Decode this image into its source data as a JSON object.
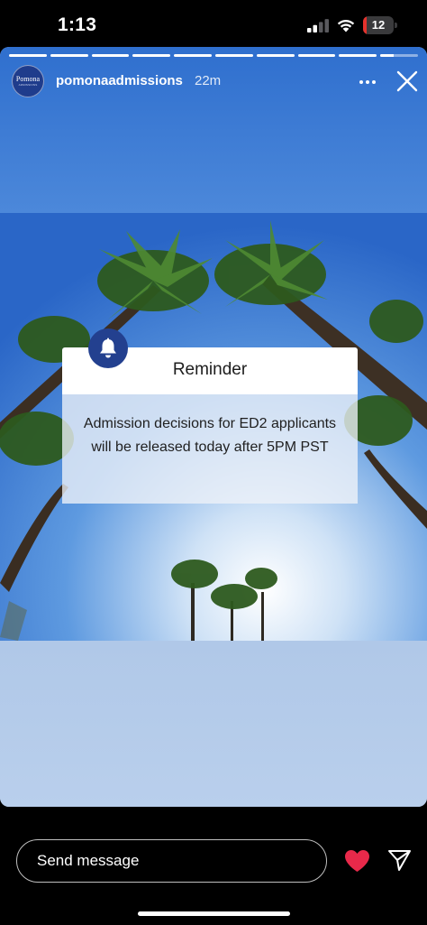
{
  "status_bar": {
    "time": "1:13",
    "battery_level": "12",
    "battery_fraction": 0.12,
    "signal_bars_active": 2,
    "signal_bars_total": 4
  },
  "story": {
    "segments_total": 10,
    "segments_viewed": 9,
    "username": "pomonaadmissions",
    "time_ago": "22m",
    "avatar_text": "Pomona",
    "avatar_subtext": "ADMISSIONS",
    "more_icon": "more-horizontal-icon",
    "close_icon": "close-icon"
  },
  "reminder": {
    "title": "Reminder",
    "body": "Admission decisions for ED2 applicants will be released today after 5PM PST",
    "icon": "bell-icon"
  },
  "reply": {
    "placeholder": "Send message",
    "like_icon": "heart-icon",
    "share_icon": "send-icon"
  },
  "colors": {
    "accent_like": "#e8294a",
    "badge_blue": "#23408f",
    "sky_blue": "#2f6fce",
    "battery_red": "#e5322d"
  }
}
